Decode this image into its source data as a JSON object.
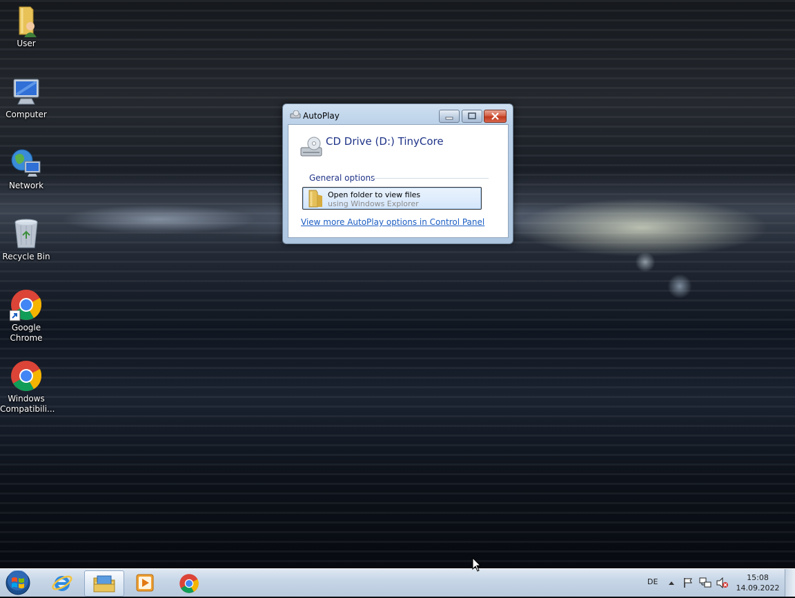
{
  "desktop": {
    "icons": [
      {
        "label": "User",
        "icon": "user-folder-icon"
      },
      {
        "label": "Computer",
        "icon": "computer-icon"
      },
      {
        "label": "Network",
        "icon": "network-icon"
      },
      {
        "label": "Recycle Bin",
        "icon": "recycle-bin-icon"
      },
      {
        "label_line1": "Google",
        "label_line2": "Chrome",
        "icon": "chrome-icon"
      },
      {
        "label_line1": "Windows",
        "label_line2": "Compatibili...",
        "icon": "chrome-icon"
      }
    ]
  },
  "autoplay": {
    "title": "AutoPlay",
    "drive_title": "CD Drive (D:) TinyCore",
    "section_heading": "General options",
    "option": {
      "title": "Open folder to view files",
      "subtitle": "using Windows Explorer",
      "icon": "folder-icon"
    },
    "control_panel_link": "View more AutoPlay options in Control Panel"
  },
  "taskbar": {
    "start_icon": "windows-start-icon",
    "pinned": [
      {
        "name": "Internet Explorer",
        "icon": "internet-explorer-icon",
        "active": false
      },
      {
        "name": "Windows Explorer",
        "icon": "windows-explorer-icon",
        "active": true
      },
      {
        "name": "Windows Media Player",
        "icon": "media-player-icon",
        "active": false
      },
      {
        "name": "Google Chrome",
        "icon": "chrome-icon",
        "active": false
      }
    ],
    "tray": {
      "language": "DE",
      "time": "15:08",
      "date": "14.09.2022"
    }
  },
  "colors": {
    "link": "#1a5cc2",
    "heading": "#1e3287",
    "close_button": "#c7432a"
  }
}
